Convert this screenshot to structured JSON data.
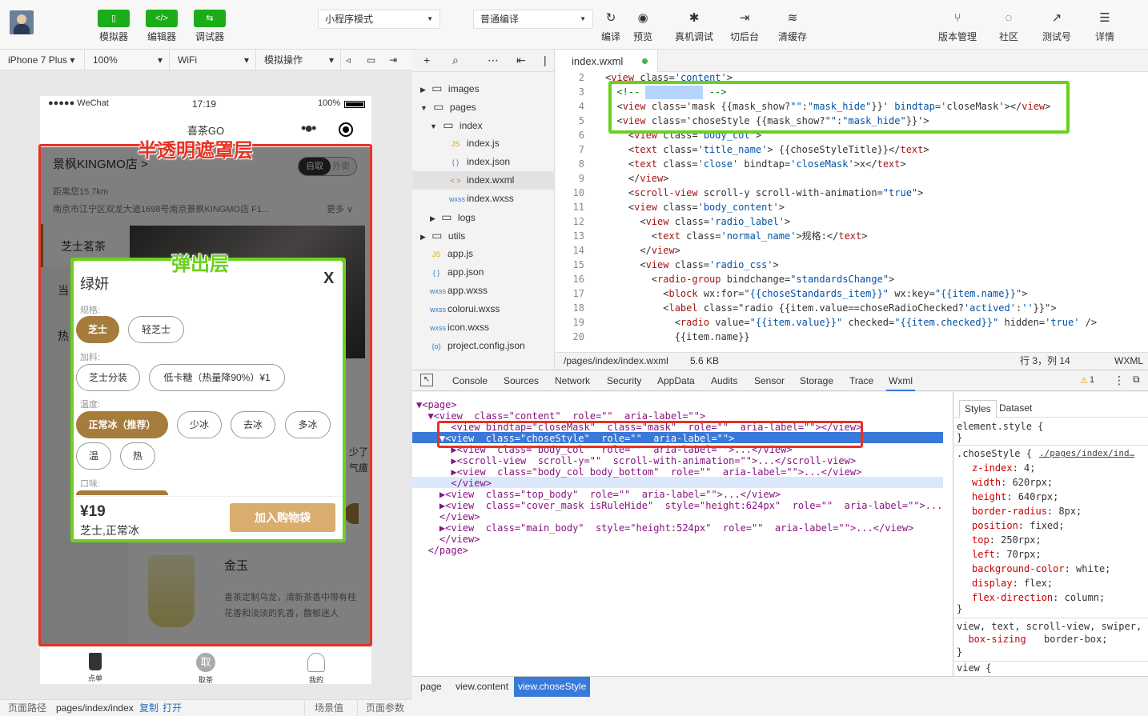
{
  "toolbar": {
    "simulator": "模拟器",
    "editor": "编辑器",
    "debugger": "调试器",
    "mode_select": "小程序模式",
    "compile_select": "普通编译",
    "compile": "编译",
    "preview": "预览",
    "real_debug": "真机调试",
    "background": "切后台",
    "clear_cache": "清缓存",
    "version": "版本管理",
    "community": "社区",
    "test": "测试号",
    "details": "详情"
  },
  "subbar": {
    "device": "iPhone 7 Plus",
    "zoom": "100%",
    "network": "WiFi",
    "sim_op": "模拟操作"
  },
  "phone": {
    "signal": "●●●●● WeChat",
    "time": "17:19",
    "battery": "100%",
    "app_title": "喜茶GO",
    "store_name": "景枫KINGMO店 >",
    "pickup": "自取",
    "delivery": "外卖",
    "distance": "距离您15.7km",
    "address": "南京市江宁区双龙大道1698号南京景枫KINGMO店 F1...",
    "more": "更多 ∨",
    "cat1": "芝士茗茶",
    "cat2": "当",
    "cat3": "热",
    "side_text1": "少了",
    "side_text2": "气癔",
    "product_name": "金玉",
    "product_desc1": "喜茶定制乌龙，清新茶香中带有桂",
    "product_desc2": "花香和淡淡的乳香，馥郁迷人",
    "tabs": [
      "点单",
      "取茶",
      "我的"
    ]
  },
  "popup": {
    "title": "绿妍",
    "close": "X",
    "spec_label": "规格:",
    "spec_opts": [
      "芝士",
      "轻芝士"
    ],
    "topping_label": "加料:",
    "topping_opts": [
      "芝士分装",
      "低卡糖（热量降90%）¥1"
    ],
    "temp_label": "温度:",
    "temp_opts": [
      "正常冰（推荐）",
      "少冰",
      "去冰",
      "多冰",
      "温",
      "热"
    ],
    "taste_label": "口味:",
    "price": "¥19",
    "summary": "芝士,正常冰",
    "add_cart": "加入购物袋"
  },
  "annotations": {
    "mask": "半透明遮罩层",
    "popup": "弹出层"
  },
  "bottom": {
    "path_label": "页面路径",
    "path": "pages/index/index",
    "copy": "复制",
    "open": "打开",
    "scene": "场景值",
    "params": "页面参数"
  },
  "filetree": [
    {
      "name": "images",
      "type": "folder",
      "level": 0,
      "open": false
    },
    {
      "name": "pages",
      "type": "folder",
      "level": 0,
      "open": true
    },
    {
      "name": "index",
      "type": "folder",
      "level": 1,
      "open": true
    },
    {
      "name": "index.js",
      "type": "JS",
      "level": 2
    },
    {
      "name": "index.json",
      "type": "{ }",
      "level": 2
    },
    {
      "name": "index.wxml",
      "type": "< >",
      "level": 2
    },
    {
      "name": "index.wxss",
      "type": "wxss",
      "level": 2
    },
    {
      "name": "logs",
      "type": "folder",
      "level": 1,
      "open": false
    },
    {
      "name": "utils",
      "type": "folder",
      "level": 0,
      "open": false
    },
    {
      "name": "app.js",
      "type": "JS",
      "level": 0
    },
    {
      "name": "app.json",
      "type": "{ }",
      "level": 0
    },
    {
      "name": "app.wxss",
      "type": "wxss",
      "level": 0
    },
    {
      "name": "colorui.wxss",
      "type": "wxss",
      "level": 0
    },
    {
      "name": "icon.wxss",
      "type": "wxss",
      "level": 0
    },
    {
      "name": "project.config.json",
      "type": "{o}",
      "level": 0
    }
  ],
  "editor": {
    "tab": "index.wxml",
    "file_path": "/pages/index/index.wxml",
    "file_size": "5.6 KB",
    "cursor": "行 3，列 14",
    "lang": "WXML"
  },
  "code_lines": [
    {
      "n": "2",
      "t": "<view class='content'>"
    },
    {
      "n": "3",
      "t": "  <!-- 半透明遮罩层 -->"
    },
    {
      "n": "4",
      "t": "  <view class='mask {{mask_show?\"\":\"mask_hide\"}}' bindtap='closeMask'></view>"
    },
    {
      "n": "5",
      "t": "  <view class='choseStyle {{mask_show?\"\":\"mask_hide\"}}'>"
    },
    {
      "n": "6",
      "t": "    <view class='body_col'>"
    },
    {
      "n": "7",
      "t": "    <text class='title_name'> {{choseStyleTitle}}</text>"
    },
    {
      "n": "8",
      "t": "    <text class='close' bindtap='closeMask'>x</text>"
    },
    {
      "n": "9",
      "t": "    </view>"
    },
    {
      "n": "10",
      "t": "    <scroll-view scroll-y scroll-with-animation=\"true\">"
    },
    {
      "n": "11",
      "t": "    <view class='body_content'>"
    },
    {
      "n": "12",
      "t": "      <view class='radio_label'>"
    },
    {
      "n": "13",
      "t": "        <text class='normal_name'>规格:</text>"
    },
    {
      "n": "14",
      "t": "      </view>"
    },
    {
      "n": "15",
      "t": "      <view class='radio_css'>"
    },
    {
      "n": "16",
      "t": "        <radio-group bindchange=\"standardsChange\">"
    },
    {
      "n": "17",
      "t": "          <block wx:for=\"{{choseStandards_item}}\" wx:key=\"{{item.name}}\">"
    },
    {
      "n": "18",
      "t": "          <label class=\"radio {{item.value==choseRadioChecked?'actived':''}}\">"
    },
    {
      "n": "19",
      "t": "            <radio value=\"{{item.value}}\" checked=\"{{item.checked}}\" hidden='true' />"
    },
    {
      "n": "20",
      "t": "            {{item.name}}"
    }
  ],
  "devtabs": [
    "Console",
    "Sources",
    "Network",
    "Security",
    "AppData",
    "Audits",
    "Sensor",
    "Storage",
    "Trace",
    "Wxml"
  ],
  "warn_count": "1",
  "wxml_lines": [
    "▼<page>",
    "  ▼<view  class=\"content\"  role=\"\"  aria-label=\"\">",
    "      <view bindtap=\"closeMask\"  class=\"mask\"  role=\"\"  aria-label=\"\"></view>",
    "    ▼<view  class=\"choseStyle\"  role=\"\"  aria-label=\"\">",
    "      ▶<view  class=\"body_col\"  role=\"\"  aria-label=\"\">...</view>",
    "      ▶<scroll-view  scroll-y=\"\"  scroll-with-animation=\"\">...</scroll-view>",
    "      ▶<view  class=\"body_col body_bottom\"  role=\"\"  aria-label=\"\">...</view>",
    "      </view>",
    "    ▶<view  class=\"top_body\"  role=\"\"  aria-label=\"\">...</view>",
    "    ▶<view  class=\"cover_mask isRuleHide\"  style=\"height:624px\"  role=\"\"  aria-label=\"\">...",
    "    </view>",
    "    ▶<view  class=\"main_body\"  style=\"height:524px\"  role=\"\"  aria-label=\"\">...</view>",
    "    </view>",
    "  </page>"
  ],
  "styles": {
    "tabs": [
      "Styles",
      "Dataset"
    ],
    "element_style": "element.style {",
    "close1": "}",
    "rule_selector": ".choseStyle {",
    "rule_link": "./pages/index/ind…",
    "props": [
      {
        "p": "z-index",
        "v": "4;"
      },
      {
        "p": "width",
        "v": "620rpx;"
      },
      {
        "p": "height",
        "v": "640rpx;"
      },
      {
        "p": "border-radius",
        "v": "8px;"
      },
      {
        "p": "position",
        "v": "fixed;"
      },
      {
        "p": "top",
        "v": "250rpx;"
      },
      {
        "p": "left",
        "v": "70rpx;"
      },
      {
        "p": "background-color",
        "v": "white;"
      },
      {
        "p": "display",
        "v": "flex;"
      },
      {
        "p": "flex-direction",
        "v": "column;"
      }
    ],
    "close2": "}",
    "rule2": "view, text, scroll-view, swiper,",
    "rule2_prop": "  box-sizing",
    "rule2_val": "border-box;",
    "close3": "}",
    "rule3": "view {"
  },
  "crumbs": [
    "page",
    "view.content",
    "view.choseStyle"
  ]
}
